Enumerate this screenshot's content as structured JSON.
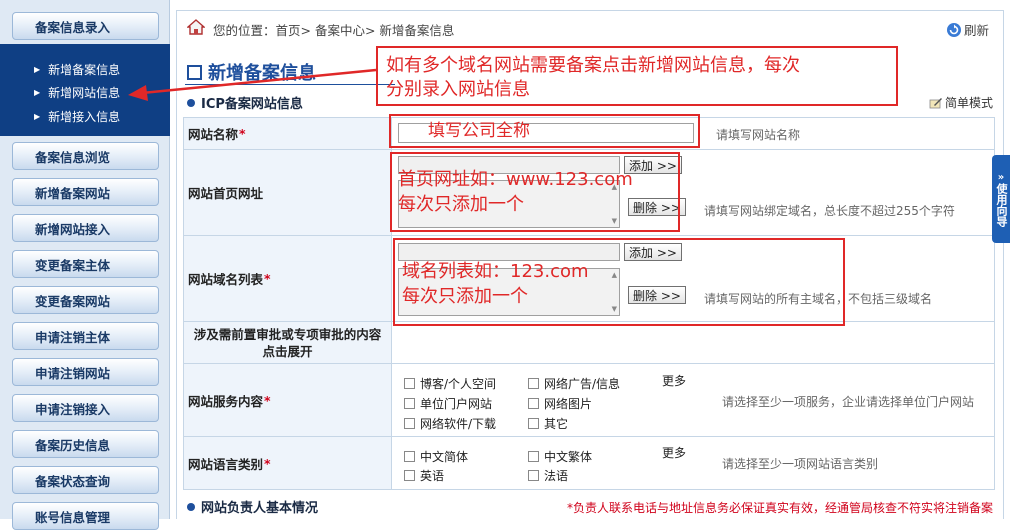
{
  "sidebar": {
    "groups": [
      {
        "label": "备案信息录入"
      },
      {
        "label": "备案信息浏览"
      },
      {
        "label": "新增备案网站"
      },
      {
        "label": "新增网站接入"
      },
      {
        "label": "变更备案主体"
      },
      {
        "label": "变更备案网站"
      },
      {
        "label": "申请注销主体"
      },
      {
        "label": "申请注销网站"
      },
      {
        "label": "申请注销接入"
      },
      {
        "label": "备案历史信息"
      },
      {
        "label": "备案状态查询"
      },
      {
        "label": "账号信息管理"
      }
    ],
    "sub_items": [
      {
        "label": "新增备案信息"
      },
      {
        "label": "新增网站信息"
      },
      {
        "label": "新增接入信息"
      }
    ]
  },
  "header": {
    "breadcrumb": "您的位置：首页> 备案中心> 新增备案信息",
    "refresh_label": "刷新"
  },
  "main": {
    "title": "新增备案信息",
    "section_icp": "ICP备案网站信息",
    "simple_mode": "简单模式",
    "section_owner": "网站负责人基本情况",
    "owner_notice": "*负责人联系电话与地址信息务必保证真实有效，经通管局核查不符实将注销备案"
  },
  "form": {
    "site_name": {
      "label": "网站名称",
      "hint": "请填写网站名称",
      "value": ""
    },
    "homepage": {
      "label": "网站首页网址",
      "add_label": "添加 >>",
      "delete_label": "删除 >>",
      "hint": "请填写网站绑定域名，总长度不超过255个字符"
    },
    "domain_list": {
      "label": "网站域名列表",
      "add_label": "添加 >>",
      "delete_label": "删除 >>",
      "hint": "请填写网站的所有主域名，不包括三级域名"
    },
    "pre_approval": {
      "label_line1": "涉及需前置审批或专项审批的内容",
      "label_line2": "点击展开"
    },
    "services": {
      "label": "网站服务内容",
      "options": [
        "博客/个人空间",
        "网络广告/信息",
        "单位门户网站",
        "网络图片",
        "网络软件/下载",
        "其它"
      ],
      "more": "更多",
      "hint": "请选择至少一项服务，企业请选择单位门户网站"
    },
    "languages": {
      "label": "网站语言类别",
      "options": [
        "中文简体",
        "中文繁体",
        "英语",
        "法语"
      ],
      "more": "更多",
      "hint": "请选择至少一项网站语言类别"
    },
    "required_mark": "*"
  },
  "guide_tab": "使用向导",
  "annotations": {
    "top_note": "如有多个域名网站需要备案点击新增网站信息，每次分别录入网站信息",
    "top_note_line1": "如有多个域名网站需要备案点击新增网站信息，每次",
    "top_note_line2": "分别录入网站信息",
    "site_name_note": "填写公司全称",
    "homepage_note_line1": "首页网址如：www.123.com",
    "homepage_note_line2": "每次只添加一个",
    "domain_note_line1": "域名列表如：123.com",
    "domain_note_line2": "每次只添加一个",
    "color": "#e02828"
  },
  "colors": {
    "sidebar_sub_bg": "#0f3f84",
    "title_blue": "#1e4f9c",
    "label_bg": "#eef4fb",
    "required_red": "#d0021b"
  }
}
